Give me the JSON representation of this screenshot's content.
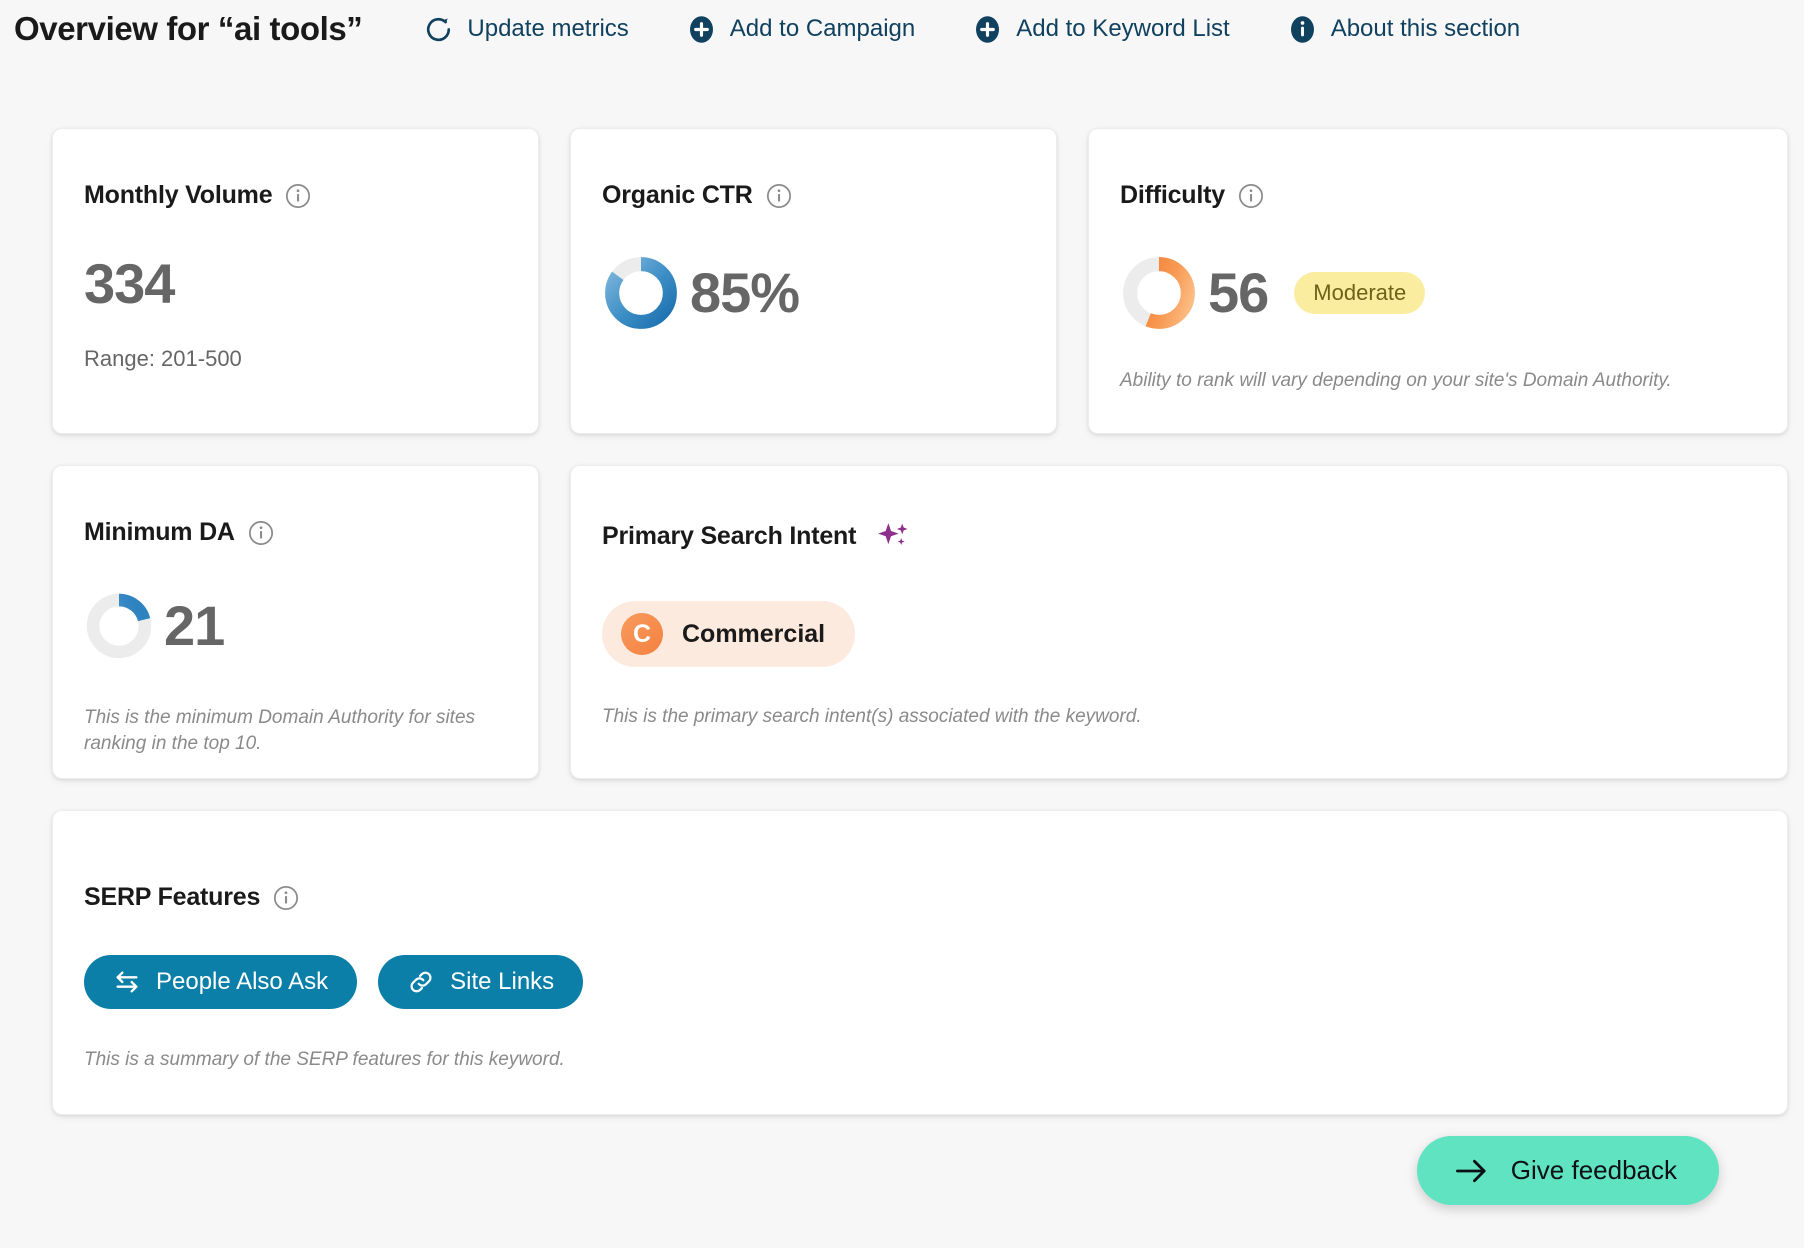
{
  "header": {
    "title": "Overview for “ai tools”",
    "actions": [
      {
        "label": "Update metrics",
        "icon": "refresh-icon"
      },
      {
        "label": "Add to Campaign",
        "icon": "plus-circle-icon"
      },
      {
        "label": "Add to Keyword List",
        "icon": "plus-circle-icon"
      },
      {
        "label": "About this section",
        "icon": "info-circle-icon"
      }
    ],
    "link_color": "#10415f"
  },
  "cards": {
    "monthly_volume": {
      "title": "Monthly Volume",
      "value": "334",
      "range": "Range: 201-500"
    },
    "organic_ctr": {
      "title": "Organic CTR",
      "value": "85%",
      "percent": 85,
      "arc_start_color": "#7fb6dd",
      "arc_end_color": "#1b6fae"
    },
    "difficulty": {
      "title": "Difficulty",
      "value": "56",
      "percent": 56,
      "badge": "Moderate",
      "badge_bg": "#faeda0",
      "badge_color": "#6d6218",
      "arc_start_color": "#f68a3c",
      "arc_end_color": "#fbb778",
      "note": "Ability to rank will vary depending on your site's Domain Authority."
    },
    "minimum_da": {
      "title": "Minimum DA",
      "value": "21",
      "percent": 21,
      "arc_start_color": "#6aa9d8",
      "arc_end_color": "#2d82c0",
      "note": "This is the minimum Domain Authority for sites ranking in the top 10."
    },
    "primary_search_intent": {
      "title": "Primary Search Intent",
      "sparkle_color": "#8e2f8c",
      "intent_initial": "C",
      "intent_label": "Commercial",
      "intent_bg": "#fdeadf",
      "intent_circle_color": "#f4813f",
      "note": "This is the primary search intent(s) associated with the keyword."
    },
    "serp_features": {
      "title": "SERP Features",
      "pill_color": "#0b7fa7",
      "pills": [
        {
          "label": "People Also Ask",
          "icon": "arrows-exchange-icon"
        },
        {
          "label": "Site Links",
          "icon": "link-icon"
        }
      ],
      "note": "This is a summary of the SERP features for this keyword."
    }
  },
  "feedback": {
    "label": "Give feedback",
    "icon": "arrow-right-icon",
    "color": "#5fe3c0"
  }
}
